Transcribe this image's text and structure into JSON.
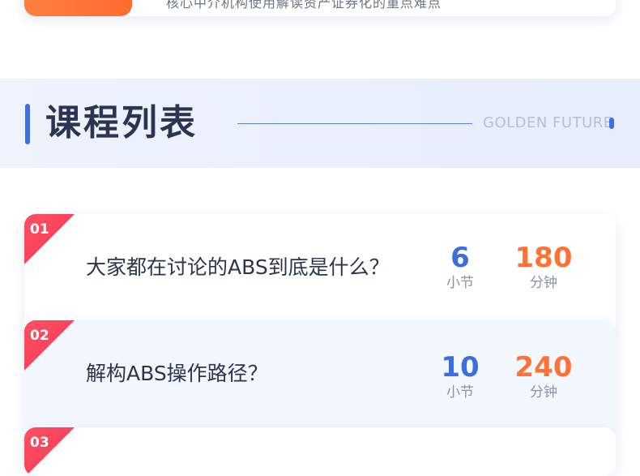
{
  "top_card": {
    "text": "核心中介机构使用解读资产证券化的重点难点"
  },
  "section": {
    "title": "课程列表",
    "subtitle_en": "GOLDEN FUTURE"
  },
  "courses": [
    {
      "num": "01",
      "title": "大家都在讨论的ABS到底是什么？",
      "lessons": "6",
      "lessons_label": "小节",
      "minutes": "180",
      "minutes_label": "分钟"
    },
    {
      "num": "02",
      "title": "解构ABS操作路径？",
      "lessons": "10",
      "lessons_label": "小节",
      "minutes": "240",
      "minutes_label": "分钟"
    },
    {
      "num": "03"
    }
  ],
  "colors": {
    "accent_blue": "#3d6ee4",
    "accent_orange": "#ff7134",
    "badge_red": "#f33a55",
    "title_dark": "#2b3450"
  }
}
